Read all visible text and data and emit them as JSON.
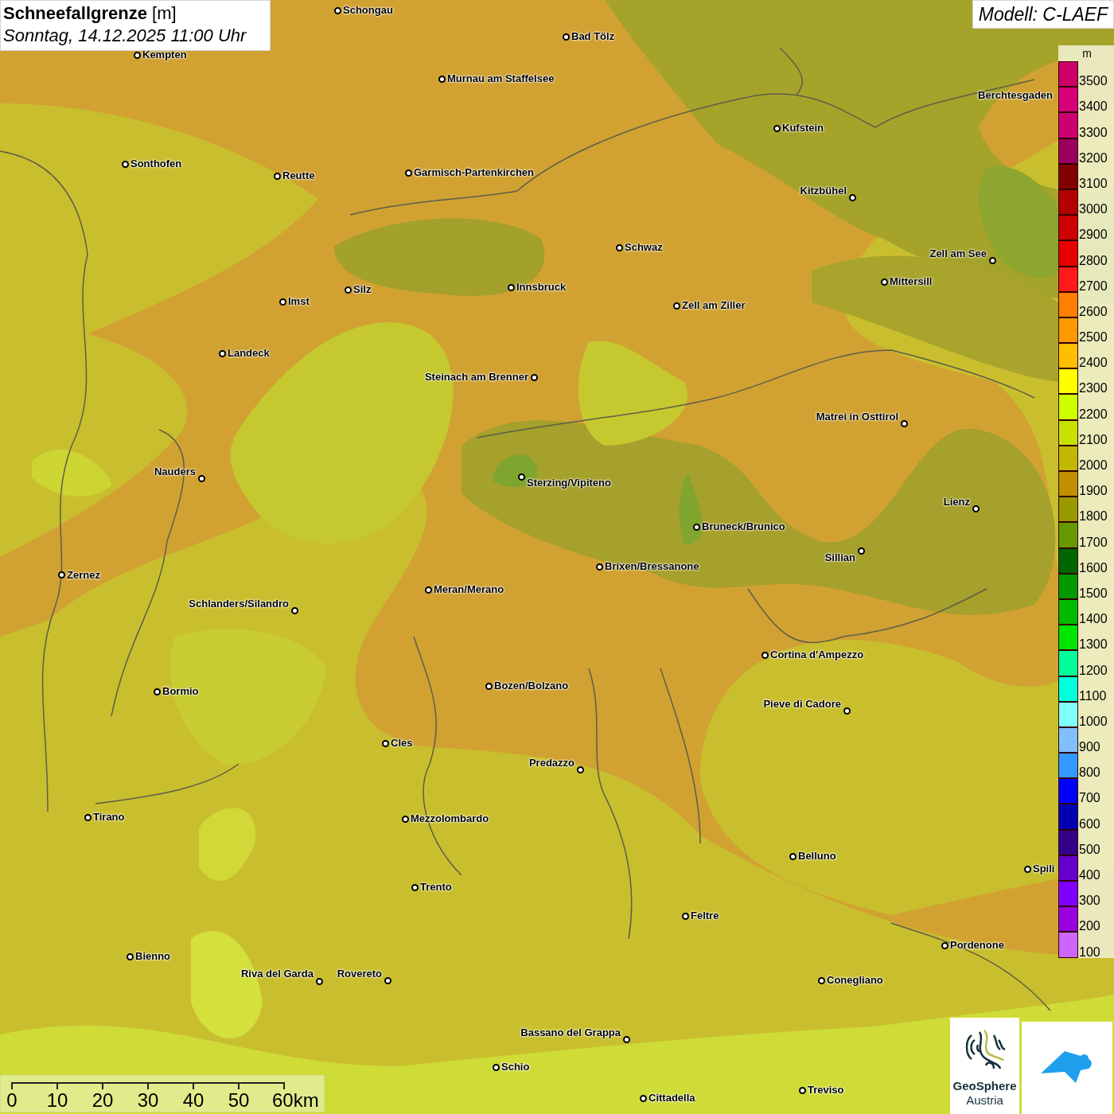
{
  "title": "**Schneefallgrenze** [m]",
  "subtitle": "Sonntag, 14.12.2025 11:00 Uhr",
  "model": "Modell: C-LAEF",
  "legend": {
    "unit": "m",
    "levels": [
      {
        "label": "3500",
        "color": "#cc0066"
      },
      {
        "label": "3400",
        "color": "#d6007a"
      },
      {
        "label": "3300",
        "color": "#cc0070"
      },
      {
        "label": "3200",
        "color": "#99005e"
      },
      {
        "label": "3100",
        "color": "#800000"
      },
      {
        "label": "3000",
        "color": "#b30000"
      },
      {
        "label": "2900",
        "color": "#cc0000"
      },
      {
        "label": "2800",
        "color": "#e60000"
      },
      {
        "label": "2700",
        "color": "#ff1a1a"
      },
      {
        "label": "2600",
        "color": "#ff8000"
      },
      {
        "label": "2500",
        "color": "#ff9900"
      },
      {
        "label": "2400",
        "color": "#ffbf00"
      },
      {
        "label": "2300",
        "color": "#ffff00"
      },
      {
        "label": "2200",
        "color": "#ccff00"
      },
      {
        "label": "2100",
        "color": "#c8e000"
      },
      {
        "label": "2000",
        "color": "#c0b800"
      },
      {
        "label": "1900",
        "color": "#c09000"
      },
      {
        "label": "1800",
        "color": "#999900"
      },
      {
        "label": "1700",
        "color": "#669900"
      },
      {
        "label": "1600",
        "color": "#006600"
      },
      {
        "label": "1500",
        "color": "#009900"
      },
      {
        "label": "1400",
        "color": "#00bb00"
      },
      {
        "label": "1300",
        "color": "#00e600"
      },
      {
        "label": "1200",
        "color": "#00ff99"
      },
      {
        "label": "1100",
        "color": "#00ffdd"
      },
      {
        "label": "1000",
        "color": "#80ffff"
      },
      {
        "label": "900",
        "color": "#80c0ff"
      },
      {
        "label": "800",
        "color": "#3399ff"
      },
      {
        "label": "700",
        "color": "#0000ff"
      },
      {
        "label": "600",
        "color": "#0000b3"
      },
      {
        "label": "500",
        "color": "#330088"
      },
      {
        "label": "400",
        "color": "#6600cc"
      },
      {
        "label": "300",
        "color": "#8000ff"
      },
      {
        "label": "200",
        "color": "#9900dd"
      },
      {
        "label": "100",
        "color": "#cc66ff"
      }
    ]
  },
  "cities": [
    {
      "name": "Schongau"
    },
    {
      "name": "Bad Tölz"
    },
    {
      "name": "Kempten"
    },
    {
      "name": "Murnau am Staffelsee"
    },
    {
      "name": "Berchtesgaden"
    },
    {
      "name": "Kufstein"
    },
    {
      "name": "Sonthofen"
    },
    {
      "name": "Reutte"
    },
    {
      "name": "Garmisch-Partenkirchen"
    },
    {
      "name": "Kitzbühel"
    },
    {
      "name": "Schwaz"
    },
    {
      "name": "Zell am See"
    },
    {
      "name": "Mittersill"
    },
    {
      "name": "Innsbruck"
    },
    {
      "name": "Silz"
    },
    {
      "name": "Imst"
    },
    {
      "name": "Zell am Ziller"
    },
    {
      "name": "Landeck"
    },
    {
      "name": "Steinach am Brenner"
    },
    {
      "name": "Matrei in Osttirol"
    },
    {
      "name": "Nauders"
    },
    {
      "name": "Sterzing/Vipiteno"
    },
    {
      "name": "Lienz"
    },
    {
      "name": "Bruneck/Brunico"
    },
    {
      "name": "Sillian"
    },
    {
      "name": "Brixen/Bressanone"
    },
    {
      "name": "Zernez"
    },
    {
      "name": "Meran/Merano"
    },
    {
      "name": "Schlanders/Silandro"
    },
    {
      "name": "Cortina d'Ampezzo"
    },
    {
      "name": "Bormio"
    },
    {
      "name": "Bozen/Bolzano"
    },
    {
      "name": "Pieve di Cadore"
    },
    {
      "name": "Cles"
    },
    {
      "name": "Predazzo"
    },
    {
      "name": "Tirano"
    },
    {
      "name": "Mezzolombardo"
    },
    {
      "name": "Belluno"
    },
    {
      "name": "Spili"
    },
    {
      "name": "Trento"
    },
    {
      "name": "Feltre"
    },
    {
      "name": "Pordenone"
    },
    {
      "name": "Bienno"
    },
    {
      "name": "Riva del Garda"
    },
    {
      "name": "Rovereto"
    },
    {
      "name": "Conegliano"
    },
    {
      "name": "Bassano del Grappa"
    },
    {
      "name": "Schio"
    },
    {
      "name": "Treviso"
    },
    {
      "name": "Cittadella"
    }
  ],
  "scale_bar": {
    "ticks": [
      "0",
      "10",
      "20",
      "30",
      "40",
      "50",
      "60km"
    ]
  },
  "logo": {
    "name": "GeoSphere",
    "subname": "Austria"
  }
}
